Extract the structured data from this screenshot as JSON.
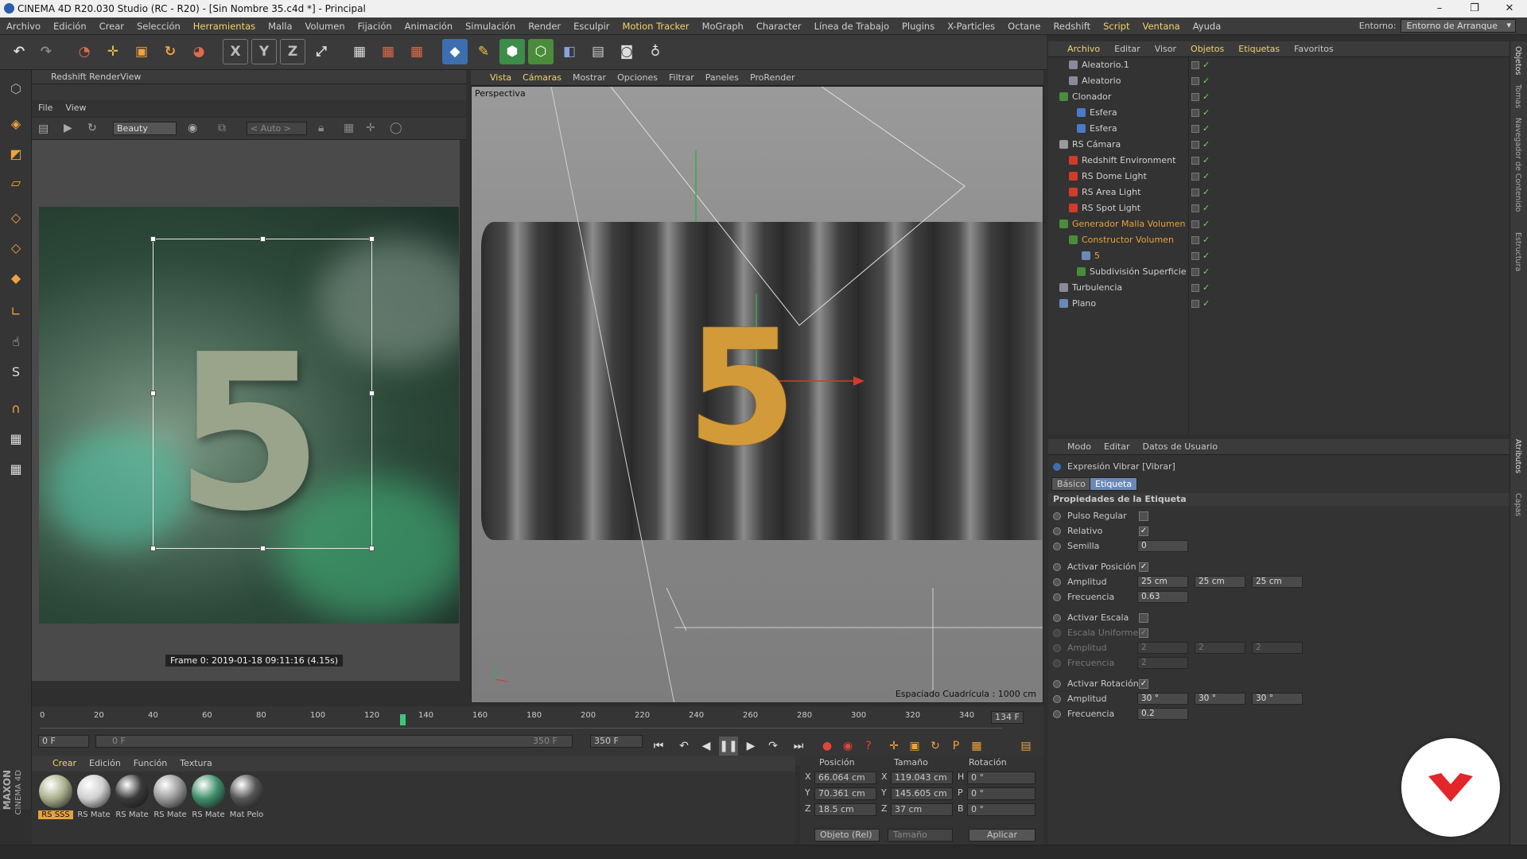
{
  "window": {
    "title": "CINEMA 4D R20.030 Studio (RC - R20) - [Sin Nombre 35.c4d *] - Principal",
    "minimize": "–",
    "maximize": "❐",
    "close": "✕"
  },
  "menu": {
    "items": [
      "Archivo",
      "Edición",
      "Crear",
      "Selección",
      "Herramientas",
      "Malla",
      "Volumen",
      "Fijación",
      "Animación",
      "Simulación",
      "Render",
      "Esculpir",
      "Motion Tracker",
      "MoGraph",
      "Character",
      "Línea de Trabajo",
      "Plugins",
      "X-Particles",
      "Octane",
      "Redshift",
      "Script",
      "Ventana",
      "Ayuda"
    ],
    "environment_label": "Entorno:",
    "environment_value": "Entorno de Arranque"
  },
  "renderview": {
    "title": "Redshift RenderView",
    "menu_file": "File",
    "menu_view": "View",
    "aov_select": "Beauty",
    "auto_select": "< Auto >",
    "frame_label": "Frame 0: 2019-01-18 09:11:16 (4.15s)",
    "render_digit": "5"
  },
  "viewport": {
    "tabs": [
      "Vista",
      "Cámaras",
      "Mostrar",
      "Opciones",
      "Filtrar",
      "Paneles",
      "ProRender"
    ],
    "label": "Perspectiva",
    "grid_spacing": "Espaciado Cuadrícula : 1000 cm",
    "digit": "5"
  },
  "object_manager": {
    "tabs": [
      "Archivo",
      "Editar",
      "Visor",
      "Objetos",
      "Etiquetas",
      "Favoritos"
    ],
    "objects": [
      {
        "name": "Aleatorio.1",
        "color": "#cfcfcf"
      },
      {
        "name": "Aleatorio",
        "color": "#cfcfcf"
      },
      {
        "name": "Clonador",
        "color": "#cfcfcf"
      },
      {
        "name": "Esfera",
        "color": "#cfcfcf"
      },
      {
        "name": "Esfera",
        "color": "#cfcfcf"
      },
      {
        "name": "RS Cámara",
        "color": "#cfcfcf"
      },
      {
        "name": "Redshift Environment",
        "color": "#cfcfcf"
      },
      {
        "name": "RS Dome Light",
        "color": "#cfcfcf"
      },
      {
        "name": "RS Area Light",
        "color": "#cfcfcf"
      },
      {
        "name": "RS Spot Light",
        "color": "#cfcfcf"
      },
      {
        "name": "Generador Malla Volumen",
        "color": "#e6a23c"
      },
      {
        "name": "Constructor Volumen",
        "color": "#e6a23c"
      },
      {
        "name": "5",
        "color": "#e6a23c"
      },
      {
        "name": "Subdivisión Superficie",
        "color": "#cfcfcf"
      },
      {
        "name": "Turbulencia",
        "color": "#cfcfcf"
      },
      {
        "name": "Plano",
        "color": "#cfcfcf"
      }
    ]
  },
  "attribute_manager": {
    "tabs": [
      "Modo",
      "Editar",
      "Datos de Usuario"
    ],
    "object_title": "Expresión Vibrar [Vibrar]",
    "subtab_basic": "Básico",
    "subtab_tag": "Etiqueta",
    "section": "Propiedades de la Etiqueta",
    "pulso_regular": "Pulso Regular",
    "relativo": "Relativo",
    "semilla": "Semilla",
    "semilla_value": "0",
    "activar_posicion": "Activar Posición",
    "amplitud_pos_label": "Amplitud",
    "amplitud_pos": [
      "25 cm",
      "25 cm",
      "25 cm"
    ],
    "frecuencia_pos_label": "Frecuencia",
    "frecuencia_pos": "0.63",
    "activar_escala": "Activar Escala",
    "escala_uniforme": "Escala Uniforme",
    "amplitud_esc_label": "Amplitud",
    "amplitud_esc": [
      "2",
      "2",
      "2"
    ],
    "frecuencia_esc_label": "Frecuencia",
    "frecuencia_esc": "2",
    "activar_rotacion": "Activar Rotación",
    "amplitud_rot_label": "Amplitud",
    "amplitud_rot": [
      "30 °",
      "30 °",
      "30 °"
    ],
    "frecuencia_rot_label": "Frecuencia",
    "frecuencia_rot": "0.2",
    "check": "✓"
  },
  "timeline": {
    "ticks": [
      "0",
      "20",
      "40",
      "60",
      "80",
      "100",
      "120",
      "140",
      "160",
      "180",
      "200",
      "220",
      "240",
      "260",
      "280",
      "300",
      "320",
      "340"
    ],
    "current_frame": "134 F",
    "start": "0 F",
    "range_start": "0 F",
    "range_end": "350 F",
    "end": "350 F",
    "playhead_frame": 134,
    "frame_max": 350
  },
  "material_manager": {
    "tabs": [
      "Crear",
      "Edición",
      "Función",
      "Textura"
    ],
    "materials": [
      {
        "name": "RS SSS",
        "color": "#a9b08a"
      },
      {
        "name": "RS Mate",
        "color": "#cfcfcf"
      },
      {
        "name": "RS Mate",
        "color": "#3a3a3a"
      },
      {
        "name": "RS Mate",
        "color": "#9a9a9a"
      },
      {
        "name": "RS Mate",
        "color": "#3f8f6a"
      },
      {
        "name": "Mat Pelo",
        "color": "#555555"
      }
    ]
  },
  "coordinates": {
    "headers": [
      "Posición",
      "Tamaño",
      "Rotación"
    ],
    "rows": [
      {
        "axis": "X",
        "pos": "66.064 cm",
        "size_axis": "X",
        "size": "119.043 cm",
        "rot_axis": "H",
        "rot": "0 °"
      },
      {
        "axis": "Y",
        "pos": "70.361 cm",
        "size_axis": "Y",
        "size": "145.605 cm",
        "rot_axis": "P",
        "rot": "0 °"
      },
      {
        "axis": "Z",
        "pos": "18.5 cm",
        "size_axis": "Z",
        "size": "37 cm",
        "rot_axis": "B",
        "rot": "0 °"
      }
    ],
    "mode": "Objeto (Rel)",
    "size_mode": "Tamaño",
    "apply": "Aplicar"
  },
  "brand": {
    "maxon": "MAXON",
    "cinema": "CINEMA 4D",
    "logo_color": "#e3262b"
  },
  "side_tabs": [
    "Objetos",
    "Tomas",
    "Navegador de Contenido",
    "Estructura",
    "Atributos",
    "Capas"
  ]
}
